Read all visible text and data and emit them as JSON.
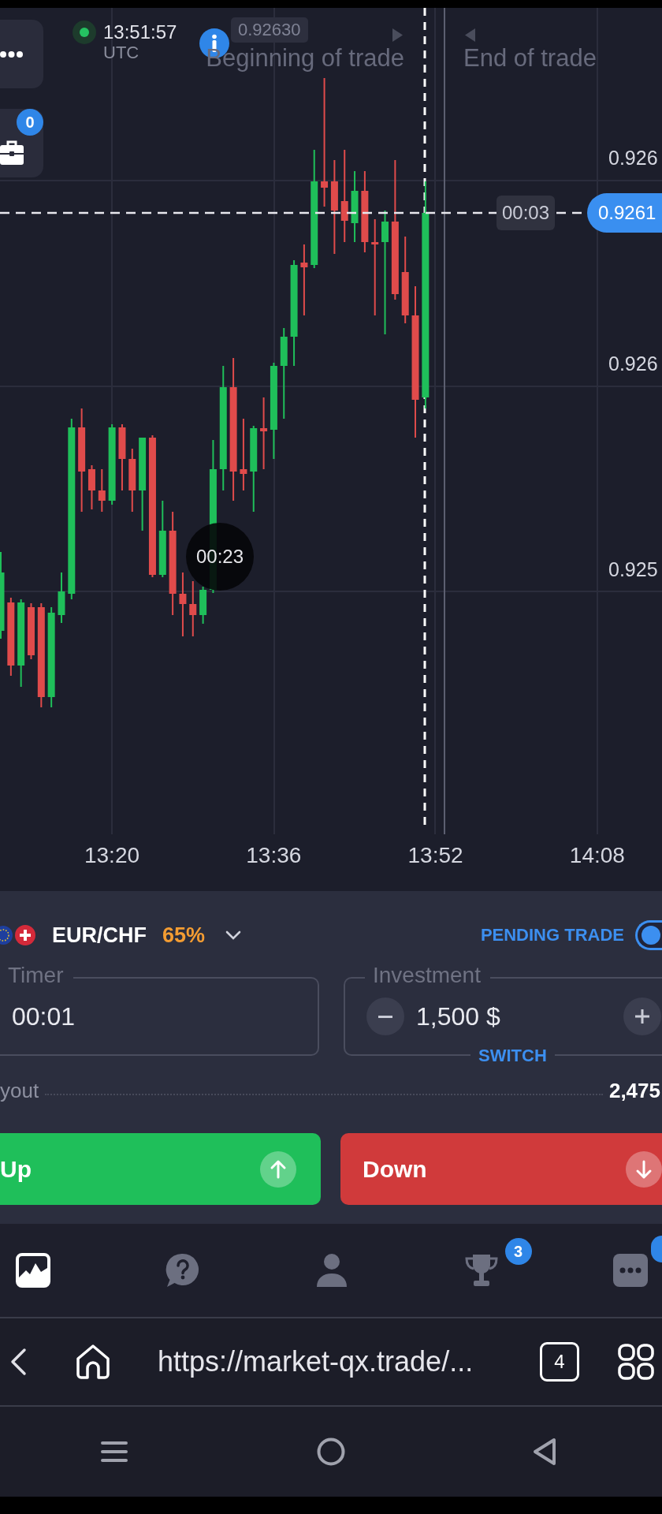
{
  "chart": {
    "clock": {
      "time": "13:51:57",
      "zone": "UTC"
    },
    "open_trades_badge": "0",
    "hover_price": "0.92630",
    "trade_markers": [
      {
        "kind": "start",
        "label": "Beginning of trade"
      },
      {
        "kind": "end",
        "label": "End of trade"
      }
    ],
    "price_labels": [
      "0.926",
      "0.926",
      "0.925"
    ],
    "time_labels": [
      "13:20",
      "13:36",
      "13:52",
      "14:08"
    ],
    "countdown": "00:03",
    "current_price": "0.9261",
    "candle_timer": "00:23"
  },
  "trade_panel": {
    "asset": {
      "pair": "EUR/CHF",
      "payout": "65%"
    },
    "pending_trade": {
      "label": "PENDING TRADE",
      "on": true
    },
    "timer": {
      "label": "Timer",
      "value": "00:01"
    },
    "investment": {
      "label": "Investment",
      "value": "1,500 $",
      "switch": "SWITCH"
    },
    "payout": {
      "label": "yout",
      "value": "2,475"
    },
    "buttons": [
      {
        "kind": "up",
        "label": "Up"
      },
      {
        "kind": "down",
        "label": "Down"
      }
    ]
  },
  "bottom_nav": [
    {
      "kind": "chart",
      "selected": true,
      "alert": false
    },
    {
      "kind": "help",
      "selected": false,
      "alert": false
    },
    {
      "kind": "profile",
      "selected": false,
      "alert": false
    },
    {
      "kind": "trophy",
      "selected": false,
      "alert": false,
      "badge": "3"
    },
    {
      "kind": "more",
      "selected": false,
      "alert": true
    }
  ],
  "browser_bar": {
    "url": "https://market-qx.trade/...",
    "tab_count": "4"
  }
}
